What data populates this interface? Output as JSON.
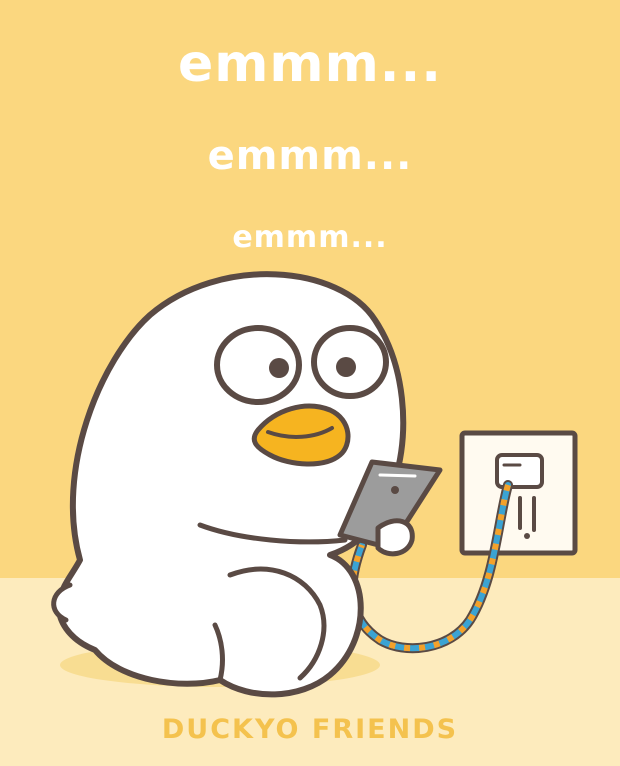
{
  "captions": {
    "line1": "emmm...",
    "line2": "emmm...",
    "line3": "emmm..."
  },
  "brand": "DUCKYO FRIENDS",
  "colors": {
    "wall": "#fbd77f",
    "floor": "#fdebbd",
    "outline": "#5a4a44",
    "beak": "#f6b420",
    "phone": "#9c9c9c",
    "cable_blue": "#3ba3d3",
    "cable_orange": "#f4a12a",
    "brand": "#f4c24e"
  }
}
